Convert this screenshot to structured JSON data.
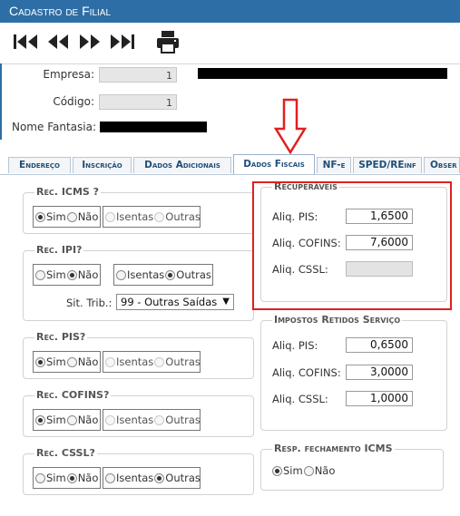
{
  "window": {
    "title": "Cadastro de Filial"
  },
  "toolbar": {
    "buttons": [
      {
        "name": "first-record-icon"
      },
      {
        "name": "previous-record-icon"
      },
      {
        "name": "next-record-icon"
      },
      {
        "name": "last-record-icon"
      },
      {
        "name": "print-icon"
      }
    ]
  },
  "header": {
    "empresa_label": "Empresa:",
    "empresa_value": "1",
    "codigo_label": "Código:",
    "codigo_value": "1",
    "nome_fantasia_label": "Nome Fantasia:"
  },
  "tabs": [
    {
      "label": "Endereço",
      "active": false
    },
    {
      "label": "Inscrição",
      "active": false
    },
    {
      "label": "Dados Adicionais",
      "active": false
    },
    {
      "label": "Dados Fiscais",
      "active": true
    },
    {
      "label": "NF-e",
      "active": false
    },
    {
      "label": "SPED/REinf",
      "active": false
    },
    {
      "label": "Obser",
      "active": false
    }
  ],
  "options": {
    "sim": "Sim",
    "nao": "Não",
    "isentas": "Isentas",
    "outras": "Outras"
  },
  "rec_icms": {
    "legend": "Rec. ICMS ?",
    "selected": "Sim"
  },
  "rec_ipi": {
    "legend": "Rec. IPI?",
    "selected_1": "Não",
    "selected_2": "Outras",
    "sit_trib_label": "Sit. Trib.:",
    "sit_trib_value": "99 - Outras Saídas"
  },
  "rec_pis": {
    "legend": "Rec. PIS?",
    "selected": "Sim"
  },
  "rec_cofins": {
    "legend": "Rec. COFINS?",
    "selected": "Sim"
  },
  "rec_cssl": {
    "legend": "Rec. CSSL?",
    "selected_1": "Não",
    "selected_2": "Outras"
  },
  "recuperaveis": {
    "legend": "Recuperáveis",
    "pis_label": "Aliq. PIS:",
    "pis_value": "1,6500",
    "cofins_label": "Aliq. COFINS:",
    "cofins_value": "7,6000",
    "cssl_label": "Aliq. CSSL:",
    "cssl_value": ""
  },
  "impostos_retidos": {
    "legend": "Impostos Retidos Serviço",
    "pis_label": "Aliq. PIS:",
    "pis_value": "0,6500",
    "cofins_label": "Aliq. COFINS:",
    "cofins_value": "3,0000",
    "cssl_label": "Aliq. CSSL:",
    "cssl_value": "1,0000"
  },
  "resp_fechamento": {
    "legend": "Resp. fechamento ICMS",
    "selected": "Sim"
  },
  "colors": {
    "title_bar": "#2e6ea6",
    "tab_text": "#1f4e79",
    "highlight": "#e0201f"
  }
}
